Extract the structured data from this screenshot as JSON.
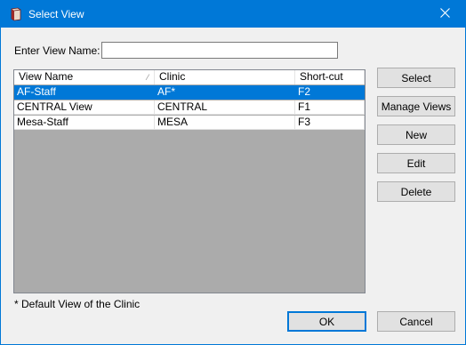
{
  "window": {
    "title": "Select View"
  },
  "form": {
    "view_name_label": "Enter View Name:",
    "view_name_value": ""
  },
  "list": {
    "columns": [
      "View Name",
      "Clinic",
      "Short-cut"
    ],
    "rows": [
      {
        "view_name": "AF-Staff",
        "clinic": "AF*",
        "shortcut": "F2",
        "selected": true
      },
      {
        "view_name": "CENTRAL View",
        "clinic": "CENTRAL",
        "shortcut": "F1",
        "selected": false
      },
      {
        "view_name": "Mesa-Staff",
        "clinic": "MESA",
        "shortcut": "F3",
        "selected": false
      }
    ]
  },
  "side_buttons": {
    "select": "Select",
    "manage_views": "Manage Views",
    "new": "New",
    "edit": "Edit",
    "delete": "Delete"
  },
  "footer": {
    "note": "* Default View of the Clinic",
    "ok": "OK",
    "cancel": "Cancel"
  },
  "colors": {
    "titlebar": "#0078d7",
    "selection": "#0078d7",
    "dialog_bg": "#f0f0f0",
    "list_empty_bg": "#ababab"
  },
  "icons": {
    "app": "app-book-icon",
    "close": "close-icon",
    "sort": "sort-indicator-icon"
  }
}
